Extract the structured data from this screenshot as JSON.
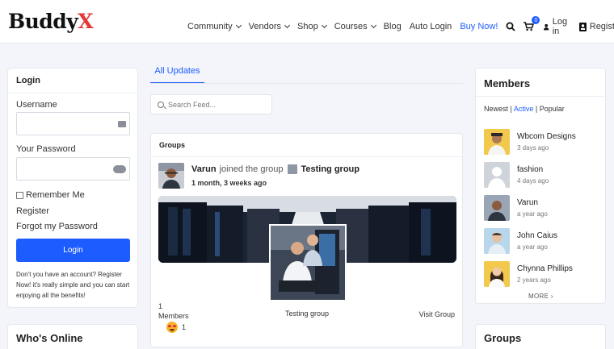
{
  "header": {
    "logo_main": "Buddy",
    "logo_accent": "X",
    "nav": [
      {
        "label": "Community",
        "dropdown": true
      },
      {
        "label": "Vendors",
        "dropdown": true
      },
      {
        "label": "Shop",
        "dropdown": true
      },
      {
        "label": "Courses",
        "dropdown": true
      },
      {
        "label": "Blog",
        "dropdown": false
      },
      {
        "label": "Auto Login",
        "dropdown": false
      },
      {
        "label": "Buy Now!",
        "dropdown": false
      }
    ],
    "cart_count": "0",
    "login_label": "Log in",
    "register_label": "Register"
  },
  "login_widget": {
    "title": "Login",
    "username_label": "Username",
    "password_label": "Your Password",
    "remember_label": "Remember Me",
    "register_link": "Register",
    "forgot_link": "Forgot my Password",
    "button_label": "Login",
    "note": "Don't you have an account? Register Now! it's really simple and you can start enjoying all the benefits!"
  },
  "whos_online": {
    "title": "Who's Online"
  },
  "activity": {
    "tab_label": "All Updates",
    "search_placeholder": "Search Feed...",
    "card_title": "Groups",
    "user": "Varun",
    "action": "joined the group",
    "group": "Testing group",
    "time": "1 month, 3 weeks ago",
    "member_count": "1",
    "members_label": "Members",
    "group_name": "Testing group",
    "visit_label": "Visit Group",
    "reaction_count": "1"
  },
  "members_widget": {
    "title": "Members",
    "filters": {
      "newest": "Newest",
      "active": "Active",
      "popular": "Popular",
      "sep": "|"
    },
    "members": [
      {
        "name": "Wbcom Designs",
        "time": "3 days ago",
        "color": "#f2c94c"
      },
      {
        "name": "fashion",
        "time": "4 days ago",
        "color": "#cfd3da"
      },
      {
        "name": "Varun",
        "time": "a year ago",
        "color": "#9aa5b5"
      },
      {
        "name": "John Caius",
        "time": "a year ago",
        "color": "#b9d7ea"
      },
      {
        "name": "Chynna Phillips",
        "time": "2 years ago",
        "color": "#f2c94c"
      }
    ],
    "more_label": "MORE"
  },
  "groups_widget": {
    "title": "Groups"
  },
  "colors": {
    "accent": "#1d5cff",
    "logo_accent": "#e53935"
  }
}
